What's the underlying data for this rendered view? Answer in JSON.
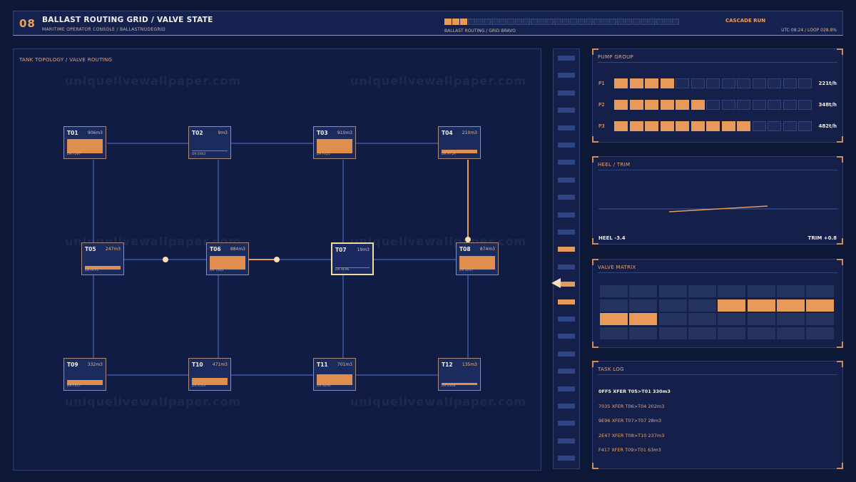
{
  "header": {
    "number": "08",
    "title": "BALLAST ROUTING GRID / VALVE STATE",
    "subtitle": "MARITIME OPERATOR CONSOLE / BALLASTNODEGRID",
    "progress": {
      "filled": 3,
      "total": 30
    },
    "grid_label": "BALLAST ROUTING / GRID BRAVO",
    "mode": "CASCADE RUN",
    "clock": "UTC 08:24 / LOOP 028.8%"
  },
  "watermark": "uniquelivewallpaper.com",
  "topology": {
    "label": "TANK TOPOLOGY / VALVE ROUTING",
    "tanks": [
      {
        "id": "T01",
        "volume": "906m3",
        "dr": "DR F287",
        "fill": 0.62
      },
      {
        "id": "T02",
        "volume": "9m3",
        "dr": "DR E662",
        "fill": 0.0
      },
      {
        "id": "T03",
        "volume": "910m3",
        "dr": "DR FE21",
        "fill": 0.62
      },
      {
        "id": "T04",
        "volume": "210m3",
        "dr": "DR 971A",
        "fill": 0.17
      },
      {
        "id": "T05",
        "volume": "247m3",
        "dr": "DR 0FF5",
        "fill": 0.17
      },
      {
        "id": "T06",
        "volume": "884m3",
        "dr": "DR 7035",
        "fill": 0.58
      },
      {
        "id": "T07",
        "volume": "19m3",
        "dr": "DR 9E96",
        "fill": 0.0
      },
      {
        "id": "T08",
        "volume": "874m3",
        "dr": "DR 2E47",
        "fill": 0.58
      },
      {
        "id": "T09",
        "volume": "332m3",
        "dr": "DR F417",
        "fill": 0.22
      },
      {
        "id": "T10",
        "volume": "471m3",
        "dr": "DR 0504",
        "fill": 0.3
      },
      {
        "id": "T11",
        "volume": "701m3",
        "dr": "DR 4EA0",
        "fill": 0.46
      },
      {
        "id": "T12",
        "volume": "135m3",
        "dr": "DR 0108",
        "fill": 0.08
      }
    ]
  },
  "level_strip": {
    "on_bars": [
      11,
      13,
      14
    ]
  },
  "pump_group": {
    "title": "PUMP GROUP",
    "pumps": [
      {
        "name": "P1",
        "rate": "221t/h",
        "level": 4,
        "cells": 13
      },
      {
        "name": "P2",
        "rate": "348t/h",
        "level": 6,
        "cells": 13
      },
      {
        "name": "P3",
        "rate": "482t/h",
        "level": 9,
        "cells": 13
      }
    ]
  },
  "heel_trim": {
    "title": "HEEL / TRIM",
    "heel": "HEEL -3.4",
    "trim": "TRIM +0.8"
  },
  "valve_matrix": {
    "title": "VALVE MATRIX",
    "rows": [
      [
        0,
        0,
        0,
        0,
        0,
        0,
        0,
        0
      ],
      [
        0,
        0,
        0,
        0,
        1,
        1,
        1,
        1
      ],
      [
        1,
        1,
        0,
        0,
        0,
        0,
        0,
        0
      ],
      [
        0,
        0,
        0,
        0,
        0,
        0,
        0,
        0
      ]
    ]
  },
  "task_log": {
    "title": "TASK LOG",
    "entries": [
      "0FF5 XFER T05>T01 330m3",
      "7035 XFER T06>T04 202m3",
      "9E96 XFER T07>T07 28m3",
      "2E47 XFER T08>T10 237m3",
      "F417 XFER T09>T01 63m3"
    ]
  },
  "colors": {
    "accent": "#e89a5b",
    "background": "#0d1736",
    "panel": "#14204a",
    "pipe": "#3a57a8",
    "selected": "#f0dca0"
  }
}
